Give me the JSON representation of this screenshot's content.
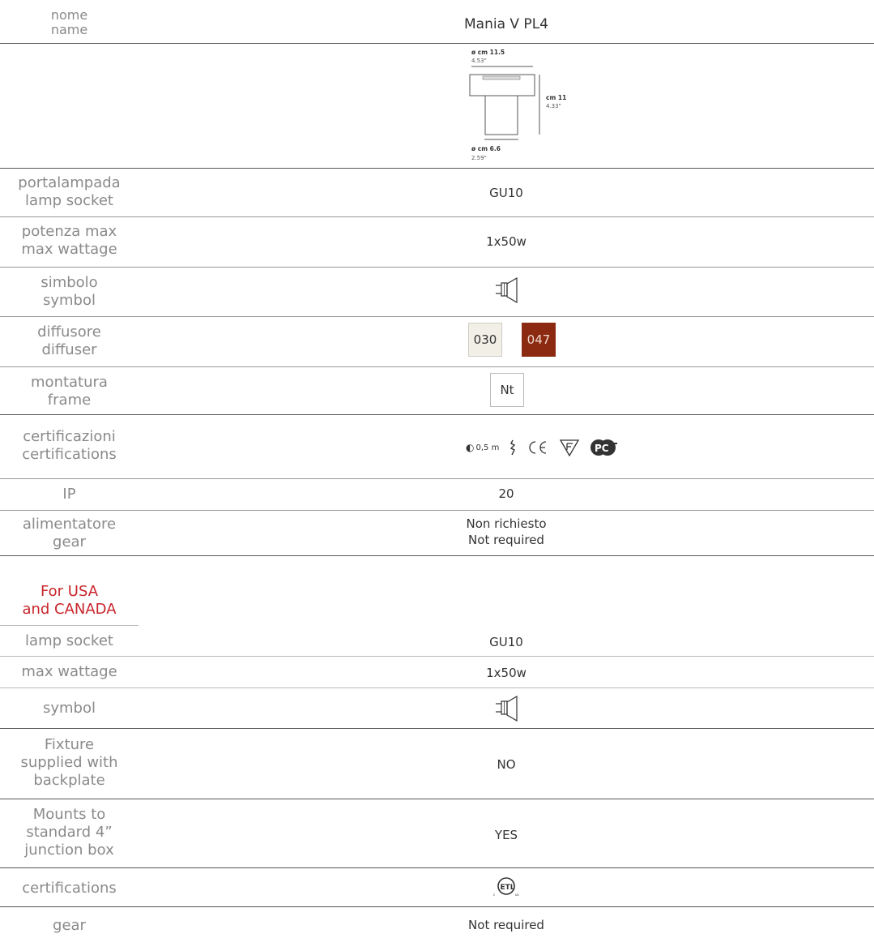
{
  "header": {
    "label_it": "nome",
    "label_en": "name",
    "product": "Mania V PL4"
  },
  "drawing": {
    "top_dim": "ø cm 11.5",
    "top_dim_in": "4.53\"",
    "height_dim": "cm 11",
    "height_dim_in": "4.33\"",
    "bottom_dim": "ø cm 6.6",
    "bottom_dim_in": "2.59\""
  },
  "rows": {
    "lamp_socket": {
      "it": "portalampada",
      "en": "lamp socket",
      "value": "GU10"
    },
    "max_wattage": {
      "it": "potenza max",
      "en": "max wattage",
      "value": "1x50w"
    },
    "symbol": {
      "it": "simbolo",
      "en": "symbol",
      "icon": "bulb-symbol-icon"
    },
    "diffuser": {
      "it": "diffusore",
      "en": "diffuser",
      "codes": [
        "030",
        "047"
      ],
      "colors": [
        "#f1efe6",
        "#8b2a10"
      ]
    },
    "frame": {
      "it": "montatura",
      "en": "frame",
      "code": "Nt"
    },
    "certifications": {
      "it": "certificazioni",
      "en": "certifications",
      "distance": "0,5 m"
    },
    "ip": {
      "label": "IP",
      "value": "20"
    },
    "gear": {
      "it": "alimentatore",
      "en": "gear",
      "value_it": "Non richiesto",
      "value_en": "Not required"
    }
  },
  "usa": {
    "heading_line1": "For USA",
    "heading_line2": "and CANADA",
    "heading_color": "#c8252b",
    "lamp_socket": {
      "label": "lamp socket",
      "value": "GU10"
    },
    "max_wattage": {
      "label": "max wattage",
      "value": "1x50w"
    },
    "symbol": {
      "label": "symbol"
    },
    "backplate": {
      "label1": "Fixture",
      "label2": "supplied with",
      "label3": "backplate",
      "value": "NO"
    },
    "junction": {
      "label1": "Mounts to",
      "label2": "standard 4”",
      "label3": "junction box",
      "value": "YES"
    },
    "certifications": {
      "label": "certifications",
      "cert_text": "ETL",
      "cert_c": "c",
      "cert_us": "us"
    },
    "gear": {
      "label": "gear",
      "value": "Not required"
    }
  }
}
